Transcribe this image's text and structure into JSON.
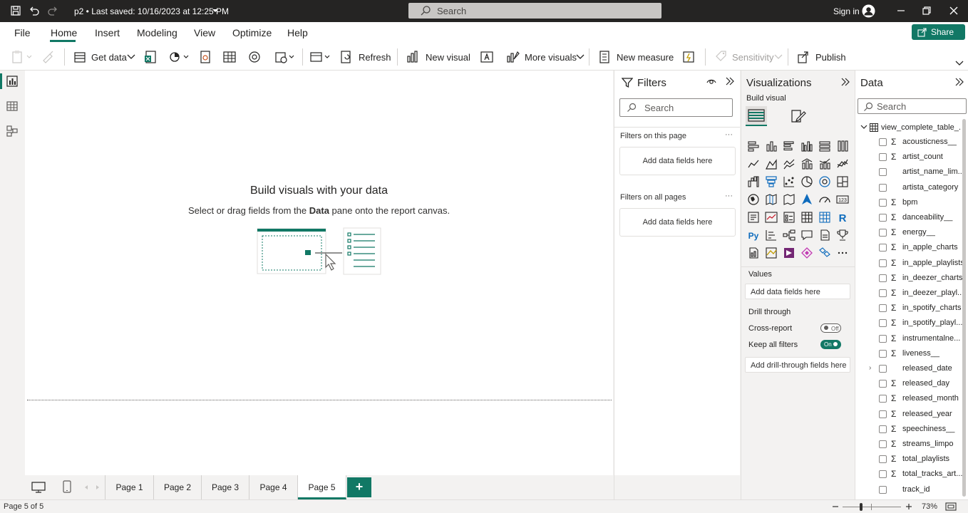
{
  "titlebar": {
    "doc_title": "p2 • Last saved: 10/16/2023 at 12:25 PM",
    "search_placeholder": "Search",
    "signin": "Sign in"
  },
  "menu": {
    "items": [
      "File",
      "Home",
      "Insert",
      "Modeling",
      "View",
      "Optimize",
      "Help"
    ],
    "active": "Home",
    "share": "Share"
  },
  "ribbon": {
    "get_data": "Get data",
    "refresh": "Refresh",
    "new_visual": "New visual",
    "more_visuals": "More visuals",
    "new_measure": "New measure",
    "sensitivity": "Sensitivity",
    "publish": "Publish"
  },
  "canvas": {
    "title": "Build visuals with your data",
    "subtitle_pre": "Select or drag fields from the ",
    "subtitle_bold": "Data",
    "subtitle_post": " pane onto the report canvas."
  },
  "filters": {
    "title": "Filters",
    "search_placeholder": "Search",
    "on_this_page": "Filters on this page",
    "on_all_pages": "Filters on all pages",
    "add_fields": "Add data fields here"
  },
  "visualizations": {
    "title": "Visualizations",
    "build_visual": "Build visual",
    "values_label": "Values",
    "values_drop": "Add data fields here",
    "drill_through": "Drill through",
    "cross_report": "Cross-report",
    "cross_report_state": "Off",
    "keep_all_filters": "Keep all filters",
    "keep_all_filters_state": "On",
    "drill_drop": "Add drill-through fields here"
  },
  "data": {
    "title": "Data",
    "search_placeholder": "Search",
    "table": "view_complete_table_...",
    "fields": [
      {
        "name": "acousticness__",
        "sigma": true
      },
      {
        "name": "artist_count",
        "sigma": true
      },
      {
        "name": "artist_name_lim...",
        "sigma": false
      },
      {
        "name": "artista_category",
        "sigma": false
      },
      {
        "name": "bpm",
        "sigma": true
      },
      {
        "name": "danceability__",
        "sigma": true
      },
      {
        "name": "energy__",
        "sigma": true
      },
      {
        "name": "in_apple_charts",
        "sigma": true
      },
      {
        "name": "in_apple_playlists",
        "sigma": true
      },
      {
        "name": "in_deezer_charts",
        "sigma": true
      },
      {
        "name": "in_deezer_playl...",
        "sigma": true
      },
      {
        "name": "in_spotify_charts",
        "sigma": true
      },
      {
        "name": "in_spotify_playl...",
        "sigma": true
      },
      {
        "name": "instrumentalne...",
        "sigma": true
      },
      {
        "name": "liveness__",
        "sigma": true
      },
      {
        "name": "released_date",
        "sigma": false
      },
      {
        "name": "released_day",
        "sigma": true
      },
      {
        "name": "released_month",
        "sigma": true
      },
      {
        "name": "released_year",
        "sigma": true
      },
      {
        "name": "speechiness__",
        "sigma": true
      },
      {
        "name": "streams_limpo",
        "sigma": true
      },
      {
        "name": "total_playlists",
        "sigma": true
      },
      {
        "name": "total_tracks_art...",
        "sigma": true
      },
      {
        "name": "track_id",
        "sigma": false
      }
    ]
  },
  "pages": {
    "tabs": [
      "Page 1",
      "Page 2",
      "Page 3",
      "Page 4",
      "Page 5"
    ],
    "active": "Page 5",
    "add": "+"
  },
  "status": {
    "page": "Page 5 of 5",
    "zoom": "73%"
  },
  "colors": {
    "accent": "#117865",
    "titlebar": "#252423"
  }
}
